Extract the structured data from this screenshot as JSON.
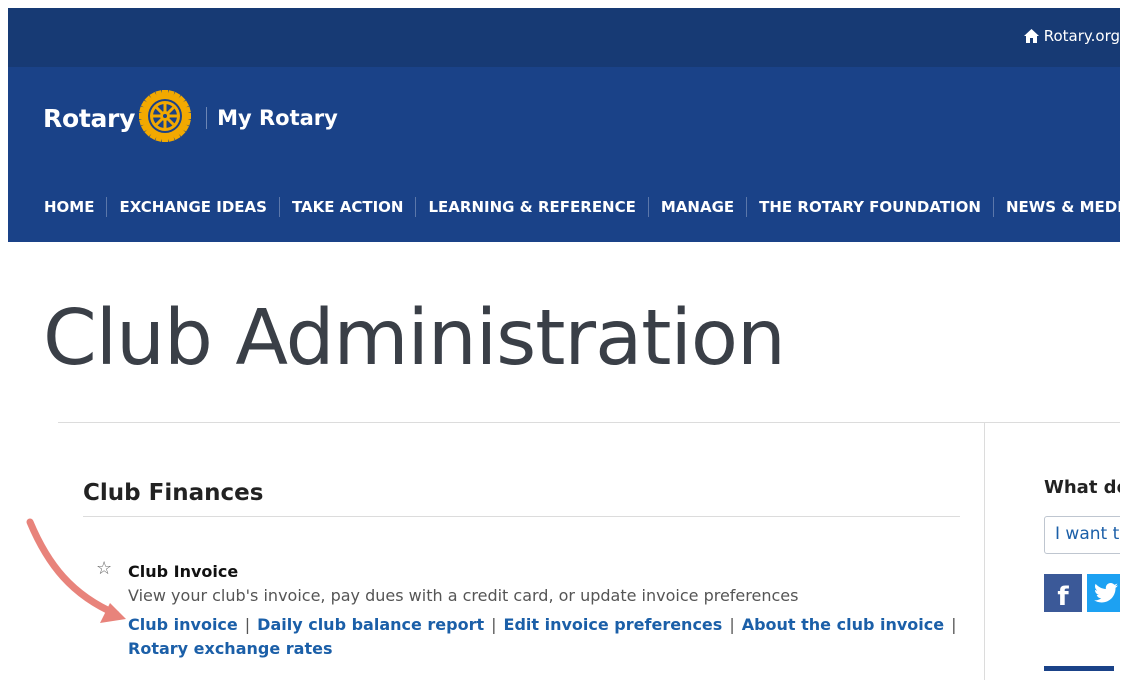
{
  "topbar": {
    "rotary_org_label": "Rotary.org"
  },
  "brand": {
    "name": "Rotary",
    "sub": "My Rotary"
  },
  "nav": [
    "HOME",
    "EXCHANGE IDEAS",
    "TAKE ACTION",
    "LEARNING & REFERENCE",
    "MANAGE",
    "THE ROTARY FOUNDATION",
    "NEWS & MEDIA"
  ],
  "page": {
    "title": "Club Administration"
  },
  "section": {
    "title": "Club Finances",
    "item": {
      "title": "Club Invoice",
      "description": "View your club's invoice, pay dues with a credit card, or update invoice preferences",
      "links_row1": [
        "Club invoice",
        "Daily club balance report",
        "Edit invoice preferences",
        "About the club invoice"
      ],
      "links_row2": [
        "Rotary exchange rates"
      ]
    }
  },
  "sidebar": {
    "title": "What do",
    "input_value": "I want t"
  },
  "icons": {
    "home": "home-icon",
    "wheel": "rotary-wheel-icon",
    "star": "star-icon",
    "facebook": "facebook-icon",
    "twitter": "twitter-icon",
    "arrow": "annotation-arrow"
  },
  "colors": {
    "topbar": "#173a74",
    "header": "#1a4288",
    "gold": "#f2a900",
    "link": "#1b5fa8",
    "arrow": "#e8837b"
  }
}
